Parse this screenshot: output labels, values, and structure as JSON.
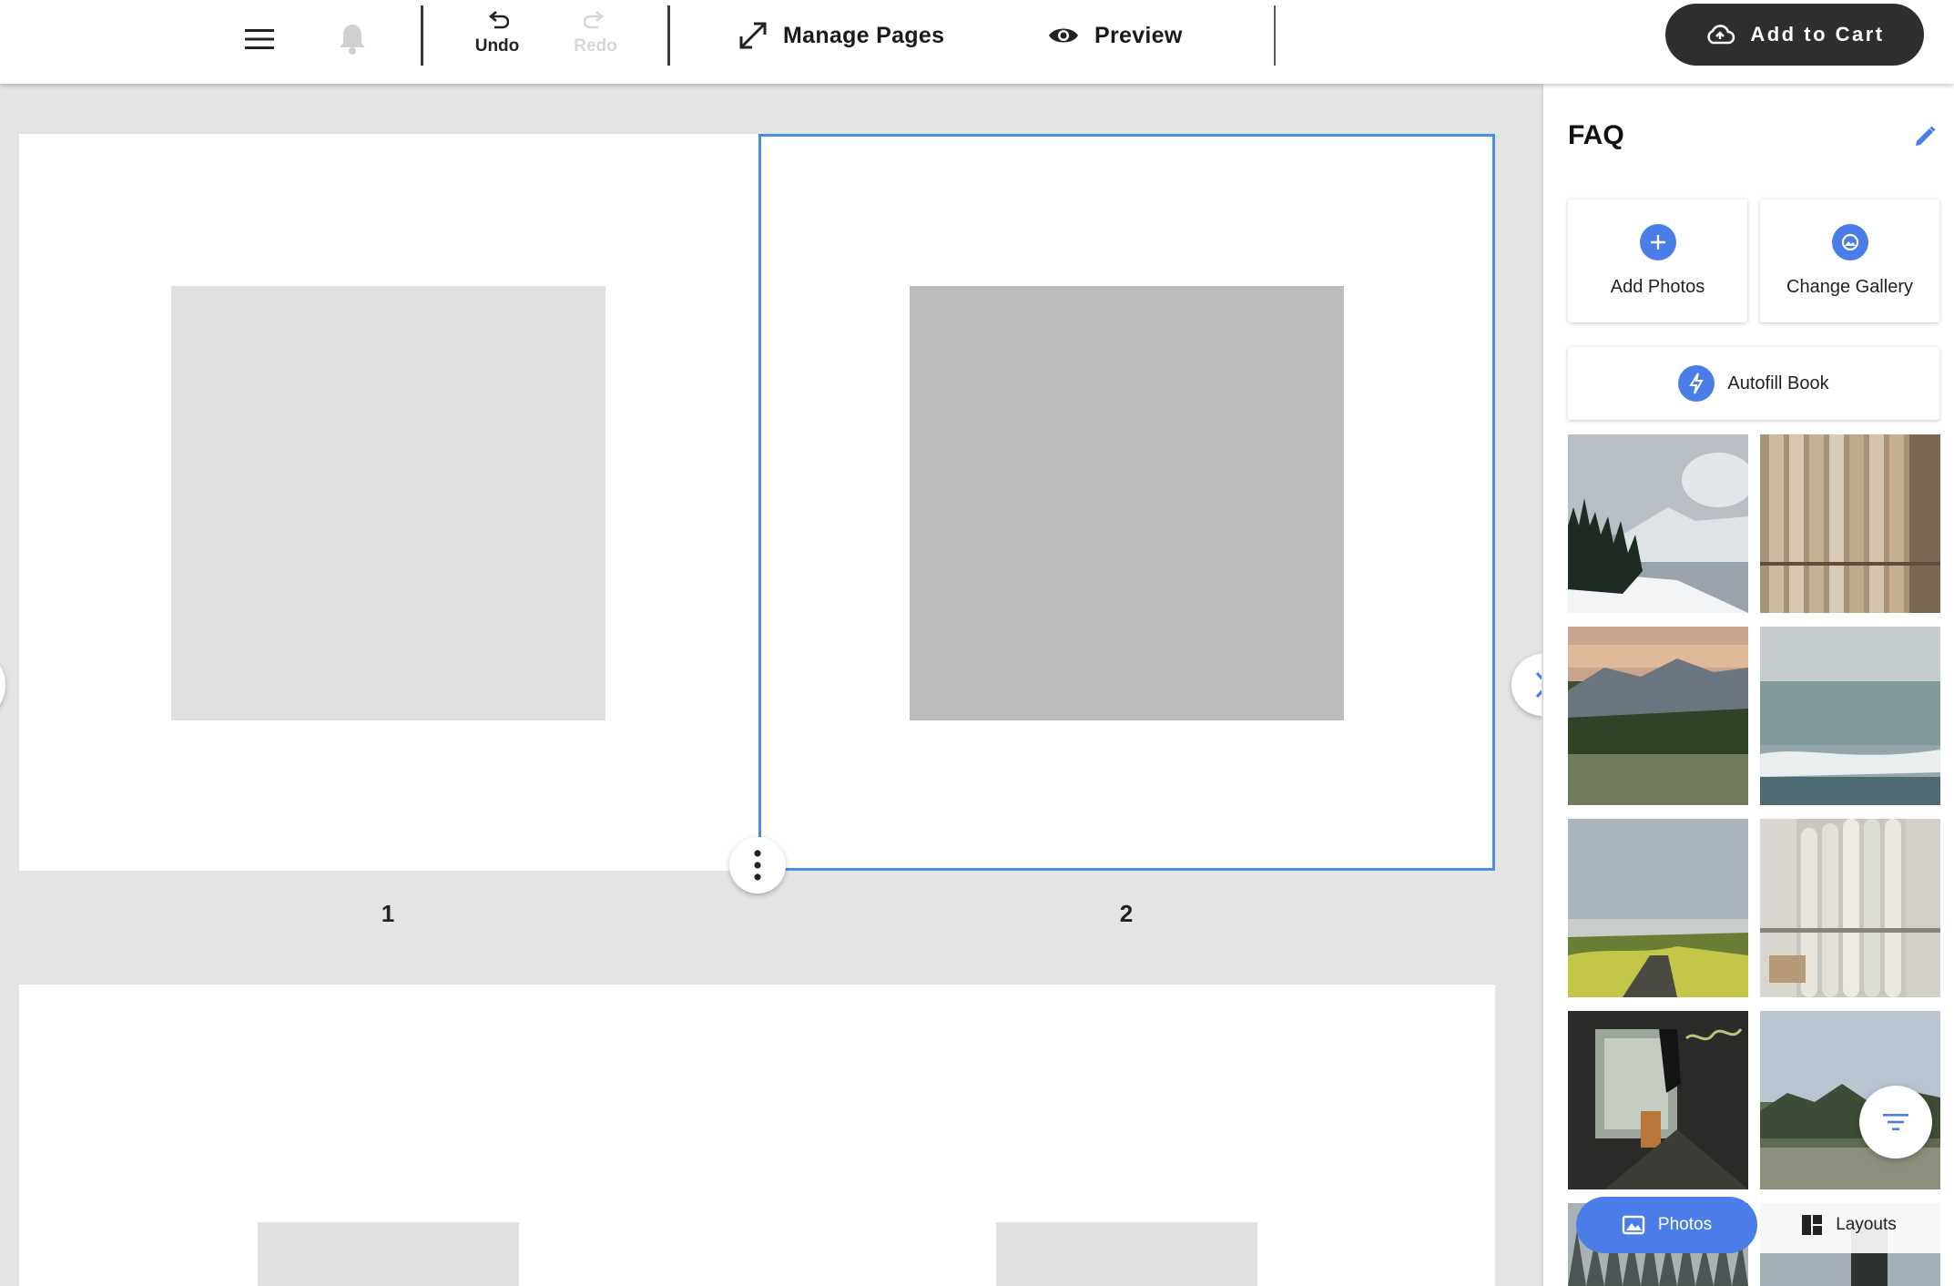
{
  "toolbar": {
    "undo_label": "Undo",
    "redo_label": "Redo",
    "manage_pages_label": "Manage Pages",
    "preview_label": "Preview",
    "add_to_cart_label": "Add to Cart"
  },
  "canvas": {
    "pages": [
      {
        "number": "1",
        "selected": false
      },
      {
        "number": "2",
        "selected": true
      }
    ]
  },
  "panel": {
    "title": "FAQ",
    "add_photos_label": "Add Photos",
    "change_gallery_label": "Change Gallery",
    "autofill_label": "Autofill Book",
    "tabs": [
      {
        "label": "Photos",
        "active": true
      },
      {
        "label": "Layouts",
        "active": false
      }
    ]
  },
  "colors": {
    "accent": "#4a7de8",
    "selection": "#4a8de8",
    "cart_button": "#2e2e2e"
  }
}
